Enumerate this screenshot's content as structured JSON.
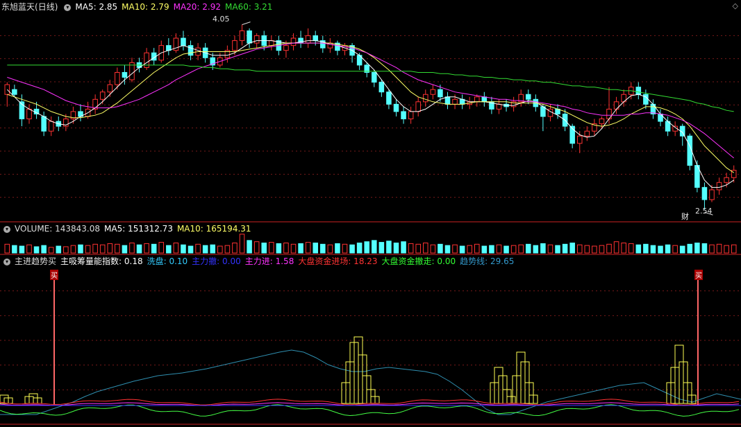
{
  "stock": {
    "name": "东旭蓝天",
    "period": "(日线)"
  },
  "colors": {
    "bg": "#000000",
    "up": "#ff3232",
    "down": "#54ffff",
    "grid": "#7a1a1a",
    "ma5": "#ffffff",
    "ma10": "#ffff66",
    "ma20": "#ff33ff",
    "ma60": "#33dd33",
    "divider": "#cc2222"
  },
  "price_panel": {
    "indicators": [
      {
        "label": "MA5: 2.85",
        "color": "#ffffff"
      },
      {
        "label": "MA10: 2.79",
        "color": "#ffff66"
      },
      {
        "label": "MA20: 2.92",
        "color": "#ff33ff"
      },
      {
        "label": "MA60: 3.21",
        "color": "#33dd33"
      }
    ],
    "high_label": "4.05",
    "low_label": "2.54",
    "fin_marker": "财"
  },
  "volume_panel": {
    "indicators": [
      {
        "label": "VOLUME: 143843.08",
        "color": "#dddddd"
      },
      {
        "label": "MA5: 151312.73",
        "color": "#ffffff"
      },
      {
        "label": "MA10: 165194.31",
        "color": "#ffff66"
      }
    ]
  },
  "indicator_panel": {
    "title": "主进趋势买",
    "indicators": [
      {
        "label": "主吸筹量能指数: 0.18",
        "color": "#ffffff"
      },
      {
        "label": "洗盘: 0.10",
        "color": "#33ccff"
      },
      {
        "label": "主力撤: 0.00",
        "color": "#3333ff"
      },
      {
        "label": "主力进: 1.58",
        "color": "#ff33ff"
      },
      {
        "label": "大盘资金进场: 18.23",
        "color": "#ff3333"
      },
      {
        "label": "大盘资金撤走: 0.00",
        "color": "#33ff33"
      },
      {
        "label": "趋势线: 29.65",
        "color": "#3399cc"
      }
    ],
    "buy_label": "买"
  },
  "chart_data": {
    "type": "candlestick",
    "price_ylim": [
      2.45,
      4.15
    ],
    "high_value": 4.05,
    "low_value": 2.54,
    "candles": [
      [
        3.48,
        3.56,
        3.42,
        3.38,
        3.58
      ],
      [
        3.52,
        3.48,
        3.46,
        3.56
      ],
      [
        3.42,
        3.28,
        3.22,
        3.48
      ],
      [
        3.28,
        3.36,
        3.24,
        3.4
      ],
      [
        3.36,
        3.32,
        3.28,
        3.42
      ],
      [
        3.3,
        3.18,
        3.14,
        3.34
      ],
      [
        3.18,
        3.26,
        3.14,
        3.3
      ],
      [
        3.26,
        3.22,
        3.18,
        3.3
      ],
      [
        3.22,
        3.28,
        3.18,
        3.32
      ],
      [
        3.28,
        3.34,
        3.24,
        3.38
      ],
      [
        3.34,
        3.3,
        3.26,
        3.4
      ],
      [
        3.3,
        3.36,
        3.28,
        3.42
      ],
      [
        3.36,
        3.44,
        3.32,
        3.48
      ],
      [
        3.44,
        3.5,
        3.4,
        3.52
      ],
      [
        3.5,
        3.56,
        3.46,
        3.6
      ],
      [
        3.56,
        3.66,
        3.52,
        3.7
      ],
      [
        3.66,
        3.62,
        3.56,
        3.72
      ],
      [
        3.6,
        3.74,
        3.58,
        3.78
      ],
      [
        3.74,
        3.7,
        3.66,
        3.78
      ],
      [
        3.7,
        3.82,
        3.68,
        3.86
      ],
      [
        3.82,
        3.76,
        3.72,
        3.86
      ],
      [
        3.76,
        3.88,
        3.74,
        3.92
      ],
      [
        3.88,
        3.84,
        3.8,
        3.94
      ],
      [
        3.84,
        3.94,
        3.82,
        3.98
      ],
      [
        3.94,
        3.88,
        3.84,
        4.0
      ],
      [
        3.88,
        3.8,
        3.76,
        3.92
      ],
      [
        3.8,
        3.86,
        3.76,
        3.9
      ],
      [
        3.86,
        3.78,
        3.74,
        3.9
      ],
      [
        3.78,
        3.72,
        3.68,
        3.82
      ],
      [
        3.72,
        3.78,
        3.7,
        3.82
      ],
      [
        3.78,
        3.84,
        3.74,
        3.88
      ],
      [
        3.84,
        3.92,
        3.8,
        3.96
      ],
      [
        3.92,
        4.0,
        3.88,
        4.05
      ],
      [
        4.0,
        3.9,
        3.86,
        4.02
      ],
      [
        3.9,
        3.96,
        3.86,
        3.98
      ],
      [
        3.96,
        3.88,
        3.84,
        4.0
      ],
      [
        3.88,
        3.92,
        3.84,
        3.96
      ],
      [
        3.92,
        3.84,
        3.8,
        3.96
      ],
      [
        3.84,
        3.88,
        3.78,
        3.92
      ],
      [
        3.88,
        3.94,
        3.84,
        3.98
      ],
      [
        3.94,
        3.9,
        3.86,
        4.0
      ],
      [
        3.9,
        3.96,
        3.86,
        4.02
      ],
      [
        3.96,
        3.92,
        3.88,
        4.0
      ],
      [
        3.92,
        3.86,
        3.82,
        3.96
      ],
      [
        3.86,
        3.9,
        3.82,
        3.94
      ],
      [
        3.9,
        3.84,
        3.8,
        3.92
      ],
      [
        3.84,
        3.88,
        3.8,
        3.9
      ],
      [
        3.88,
        3.8,
        3.74,
        3.9
      ],
      [
        3.8,
        3.72,
        3.68,
        3.82
      ],
      [
        3.72,
        3.66,
        3.62,
        3.74
      ],
      [
        3.66,
        3.58,
        3.54,
        3.68
      ],
      [
        3.58,
        3.5,
        3.46,
        3.6
      ],
      [
        3.5,
        3.4,
        3.36,
        3.52
      ],
      [
        3.4,
        3.34,
        3.3,
        3.44
      ],
      [
        3.34,
        3.28,
        3.24,
        3.38
      ],
      [
        3.28,
        3.34,
        3.24,
        3.38
      ],
      [
        3.34,
        3.42,
        3.3,
        3.46
      ],
      [
        3.42,
        3.48,
        3.38,
        3.52
      ],
      [
        3.48,
        3.52,
        3.44,
        3.56
      ],
      [
        3.52,
        3.46,
        3.42,
        3.56
      ],
      [
        3.46,
        3.4,
        3.36,
        3.5
      ],
      [
        3.4,
        3.44,
        3.36,
        3.48
      ],
      [
        3.44,
        3.4,
        3.36,
        3.48
      ],
      [
        3.4,
        3.42,
        3.36,
        3.46
      ],
      [
        3.42,
        3.46,
        3.38,
        3.48
      ],
      [
        3.46,
        3.42,
        3.38,
        3.5
      ],
      [
        3.42,
        3.36,
        3.32,
        3.46
      ],
      [
        3.36,
        3.4,
        3.32,
        3.44
      ],
      [
        3.4,
        3.38,
        3.34,
        3.44
      ],
      [
        3.38,
        3.42,
        3.34,
        3.46
      ],
      [
        3.42,
        3.48,
        3.38,
        3.52
      ],
      [
        3.48,
        3.44,
        3.4,
        3.52
      ],
      [
        3.44,
        3.38,
        3.34,
        3.48
      ],
      [
        3.38,
        3.3,
        3.18,
        3.4
      ],
      [
        3.3,
        3.36,
        3.26,
        3.4
      ],
      [
        3.36,
        3.32,
        3.28,
        3.4
      ],
      [
        3.32,
        3.22,
        3.18,
        3.36
      ],
      [
        3.22,
        3.08,
        3.04,
        3.24
      ],
      [
        3.08,
        3.14,
        3.0,
        3.18
      ],
      [
        3.14,
        3.18,
        3.1,
        3.22
      ],
      [
        3.18,
        3.24,
        3.14,
        3.28
      ],
      [
        3.24,
        3.28,
        3.2,
        3.3
      ],
      [
        3.28,
        3.36,
        3.24,
        3.54
      ],
      [
        3.36,
        3.42,
        3.32,
        3.46
      ],
      [
        3.42,
        3.48,
        3.38,
        3.52
      ],
      [
        3.48,
        3.54,
        3.44,
        3.58
      ],
      [
        3.54,
        3.48,
        3.44,
        3.58
      ],
      [
        3.48,
        3.4,
        3.36,
        3.52
      ],
      [
        3.4,
        3.32,
        3.28,
        3.44
      ],
      [
        3.32,
        3.26,
        3.22,
        3.36
      ],
      [
        3.26,
        3.18,
        3.14,
        3.3
      ],
      [
        3.18,
        3.22,
        3.14,
        3.26
      ],
      [
        3.22,
        3.14,
        3.06,
        3.24
      ],
      [
        3.14,
        2.9,
        2.86,
        3.16
      ],
      [
        2.9,
        2.72,
        2.68,
        2.94
      ],
      [
        2.72,
        2.62,
        2.54,
        2.76
      ],
      [
        2.62,
        2.7,
        2.6,
        2.74
      ],
      [
        2.7,
        2.76,
        2.66,
        2.8
      ],
      [
        2.76,
        2.8,
        2.72,
        2.84
      ],
      [
        2.8,
        2.86,
        2.76,
        2.9
      ]
    ],
    "ma_series": [
      {
        "name": "MA5",
        "color": "#ffffff",
        "values": [
          3.52,
          3.46,
          3.4,
          3.36,
          3.33,
          3.3,
          3.26,
          3.24,
          3.23,
          3.26,
          3.3,
          3.33,
          3.37,
          3.42,
          3.48,
          3.54,
          3.6,
          3.65,
          3.7,
          3.74,
          3.78,
          3.82,
          3.84,
          3.86,
          3.88,
          3.86,
          3.84,
          3.82,
          3.8,
          3.8,
          3.8,
          3.82,
          3.86,
          3.9,
          3.92,
          3.92,
          3.92,
          3.91,
          3.9,
          3.9,
          3.91,
          3.92,
          3.92,
          3.91,
          3.89,
          3.88,
          3.86,
          3.84,
          3.8,
          3.74,
          3.68,
          3.6,
          3.52,
          3.44,
          3.38,
          3.34,
          3.34,
          3.36,
          3.4,
          3.44,
          3.46,
          3.46,
          3.44,
          3.42,
          3.42,
          3.42,
          3.41,
          3.4,
          3.39,
          3.39,
          3.41,
          3.43,
          3.42,
          3.38,
          3.34,
          3.31,
          3.27,
          3.2,
          3.15,
          3.13,
          3.14,
          3.2,
          3.28,
          3.36,
          3.42,
          3.47,
          3.48,
          3.46,
          3.4,
          3.32,
          3.26,
          3.21,
          3.17,
          3.06,
          2.9,
          2.78,
          2.72,
          2.72,
          2.74,
          2.78
        ]
      },
      {
        "name": "MA10",
        "color": "#ffff66",
        "values": [
          3.48,
          3.46,
          3.44,
          3.42,
          3.4,
          3.37,
          3.34,
          3.32,
          3.3,
          3.29,
          3.29,
          3.3,
          3.31,
          3.33,
          3.37,
          3.41,
          3.46,
          3.51,
          3.56,
          3.61,
          3.66,
          3.7,
          3.74,
          3.78,
          3.81,
          3.82,
          3.83,
          3.83,
          3.83,
          3.83,
          3.83,
          3.83,
          3.84,
          3.85,
          3.86,
          3.87,
          3.88,
          3.89,
          3.9,
          3.9,
          3.9,
          3.9,
          3.9,
          3.9,
          3.9,
          3.89,
          3.88,
          3.87,
          3.85,
          3.82,
          3.78,
          3.73,
          3.68,
          3.62,
          3.56,
          3.5,
          3.46,
          3.44,
          3.42,
          3.41,
          3.4,
          3.4,
          3.4,
          3.41,
          3.42,
          3.42,
          3.42,
          3.42,
          3.42,
          3.41,
          3.41,
          3.41,
          3.41,
          3.4,
          3.38,
          3.36,
          3.34,
          3.31,
          3.28,
          3.25,
          3.23,
          3.22,
          3.23,
          3.25,
          3.28,
          3.32,
          3.35,
          3.38,
          3.38,
          3.37,
          3.35,
          3.32,
          3.28,
          3.22,
          3.14,
          3.06,
          3.0,
          2.94,
          2.88,
          2.84
        ]
      },
      {
        "name": "MA20",
        "color": "#ff33ff",
        "values": [
          3.62,
          3.6,
          3.58,
          3.56,
          3.54,
          3.52,
          3.49,
          3.46,
          3.43,
          3.41,
          3.39,
          3.38,
          3.37,
          3.37,
          3.37,
          3.38,
          3.4,
          3.42,
          3.44,
          3.47,
          3.5,
          3.53,
          3.56,
          3.6,
          3.63,
          3.66,
          3.69,
          3.71,
          3.73,
          3.75,
          3.77,
          3.79,
          3.81,
          3.83,
          3.85,
          3.86,
          3.87,
          3.88,
          3.89,
          3.9,
          3.9,
          3.9,
          3.9,
          3.9,
          3.89,
          3.88,
          3.87,
          3.86,
          3.84,
          3.82,
          3.79,
          3.76,
          3.73,
          3.7,
          3.66,
          3.63,
          3.6,
          3.58,
          3.56,
          3.54,
          3.52,
          3.5,
          3.49,
          3.48,
          3.47,
          3.46,
          3.45,
          3.44,
          3.44,
          3.43,
          3.43,
          3.42,
          3.42,
          3.41,
          3.4,
          3.39,
          3.38,
          3.36,
          3.35,
          3.33,
          3.32,
          3.31,
          3.31,
          3.31,
          3.31,
          3.32,
          3.32,
          3.33,
          3.33,
          3.32,
          3.31,
          3.29,
          3.27,
          3.24,
          3.2,
          3.16,
          3.11,
          3.06,
          3.01,
          2.96
        ]
      },
      {
        "name": "MA60",
        "color": "#33dd33",
        "values": [
          3.72,
          3.72,
          3.72,
          3.72,
          3.72,
          3.72,
          3.72,
          3.72,
          3.72,
          3.72,
          3.72,
          3.72,
          3.72,
          3.72,
          3.72,
          3.72,
          3.72,
          3.72,
          3.72,
          3.72,
          3.72,
          3.72,
          3.72,
          3.72,
          3.72,
          3.71,
          3.71,
          3.7,
          3.7,
          3.69,
          3.69,
          3.68,
          3.68,
          3.68,
          3.67,
          3.67,
          3.67,
          3.67,
          3.67,
          3.67,
          3.67,
          3.67,
          3.67,
          3.67,
          3.67,
          3.67,
          3.67,
          3.67,
          3.67,
          3.67,
          3.67,
          3.67,
          3.67,
          3.67,
          3.67,
          3.67,
          3.66,
          3.66,
          3.66,
          3.65,
          3.65,
          3.64,
          3.64,
          3.63,
          3.63,
          3.62,
          3.62,
          3.61,
          3.61,
          3.6,
          3.6,
          3.59,
          3.59,
          3.58,
          3.58,
          3.57,
          3.56,
          3.55,
          3.55,
          3.54,
          3.54,
          3.53,
          3.52,
          3.52,
          3.51,
          3.51,
          3.5,
          3.49,
          3.48,
          3.47,
          3.46,
          3.45,
          3.44,
          3.43,
          3.41,
          3.4,
          3.38,
          3.37,
          3.35,
          3.34
        ]
      }
    ],
    "volume": [
      14,
      12,
      11,
      13,
      10,
      12,
      9,
      11,
      10,
      12,
      13,
      12,
      14,
      13,
      15,
      14,
      12,
      16,
      13,
      15,
      14,
      17,
      12,
      16,
      13,
      11,
      14,
      12,
      13,
      11,
      12,
      16,
      30,
      20,
      18,
      16,
      17,
      15,
      16,
      14,
      15,
      17,
      16,
      14,
      13,
      15,
      14,
      13,
      16,
      18,
      20,
      17,
      19,
      16,
      18,
      15,
      14,
      16,
      13,
      14,
      12,
      13,
      11,
      12,
      14,
      11,
      12,
      13,
      11,
      12,
      13,
      14,
      12,
      15,
      13,
      12,
      14,
      16,
      13,
      12,
      11,
      12,
      14,
      18,
      16,
      15,
      13,
      14,
      12,
      11,
      13,
      12,
      11,
      14,
      16,
      15,
      13,
      14,
      12,
      13
    ],
    "buy_signals": [
      8,
      102
    ]
  }
}
